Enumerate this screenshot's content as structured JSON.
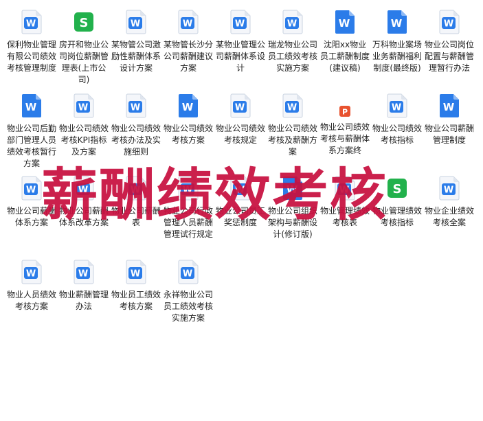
{
  "colors": {
    "doc_blue": "#2b7ce9",
    "doc_light": "#ffffff",
    "sheet_green": "#22b14c",
    "ppt_orange": "#e8522f",
    "watermark": "#c8103f"
  },
  "watermark": "薪酬绩效考核",
  "files": [
    {
      "label": "保利物业管理有限公司绩效考核管理制度",
      "icon": "word-doc-icon"
    },
    {
      "label": "房开和物业公司岗位薪酬管理表(上市公司)",
      "icon": "spreadsheet-icon"
    },
    {
      "label": "某物管公司激励性薪酬体系设计方案",
      "icon": "word-doc-icon"
    },
    {
      "label": "某物管长沙分公司薪酬建议方案",
      "icon": "word-doc-icon"
    },
    {
      "label": "某物业管理公司薪酬体系设计",
      "icon": "word-doc-icon"
    },
    {
      "label": "瑞龙物业公司员工绩效考核实施方案",
      "icon": "word-doc-icon"
    },
    {
      "label": "沈阳xx物业员工薪酬制度(建议稿)",
      "icon": "word-doc-solid-icon"
    },
    {
      "label": "万科物业案场业务薪酬福利制度(最终版)",
      "icon": "word-doc-solid-icon"
    },
    {
      "label": "物业公司岗位配置与薪酬管理暂行办法",
      "icon": "word-doc-icon"
    },
    {
      "label": "物业公司后勤部门管理人员绩效考核暂行方案",
      "icon": "word-doc-solid-icon"
    },
    {
      "label": "物业公司绩效考核KPI指标及方案",
      "icon": "word-doc-icon"
    },
    {
      "label": "物业公司绩效考核办法及实施细则",
      "icon": "word-doc-icon"
    },
    {
      "label": "物业公司绩效考核方案",
      "icon": "word-doc-solid-icon"
    },
    {
      "label": "物业公司绩效考核规定",
      "icon": "word-doc-icon"
    },
    {
      "label": "物业公司绩效考核及薪酬方案",
      "icon": "word-doc-icon"
    },
    {
      "label": "物业公司绩效考核与薪酬体系方案终",
      "icon": "ppt-icon"
    },
    {
      "label": "物业公司绩效考核指标",
      "icon": "word-doc-icon"
    },
    {
      "label": "物业公司薪酬管理制度",
      "icon": "word-doc-solid-icon"
    },
    {
      "label": "物业公司薪酬体系方案",
      "icon": "word-doc-icon"
    },
    {
      "label": "物业公司薪酬体系改革方案",
      "icon": "word-doc-icon"
    },
    {
      "label": "物业公司薪酬表",
      "icon": "word-doc-icon"
    },
    {
      "label": "物业公司行政管理人员薪酬管理试行规定",
      "icon": "word-doc-icon"
    },
    {
      "label": "物业公司员工奖惩制度",
      "icon": "word-doc-icon"
    },
    {
      "label": "物业公司组织架构与薪酬设计(修订版)",
      "icon": "word-doc-solid-icon"
    },
    {
      "label": "物业管理绩效考核表",
      "icon": "word-doc-icon"
    },
    {
      "label": "物业管理绩效考核指标",
      "icon": "spreadsheet-icon"
    },
    {
      "label": "物业企业绩效考核全案",
      "icon": "word-doc-icon"
    },
    {
      "label": "物业人员绩效考核方案",
      "icon": "word-doc-icon"
    },
    {
      "label": "物业薪酬管理办法",
      "icon": "word-doc-icon"
    },
    {
      "label": "物业员工绩效考核方案",
      "icon": "word-doc-icon"
    },
    {
      "label": "永祥物业公司员工绩效考核实施方案",
      "icon": "word-doc-icon"
    }
  ]
}
